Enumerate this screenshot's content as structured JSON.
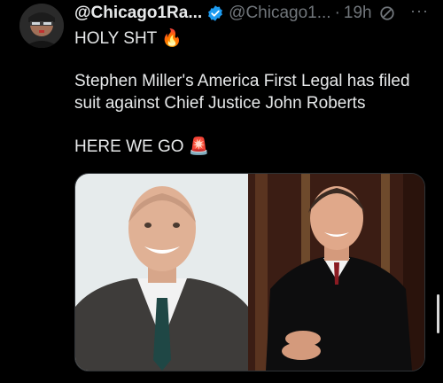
{
  "tweet": {
    "display_name": "@Chicago1Ra...",
    "handle": "@Chicago1...",
    "separator": "·",
    "time": "19h",
    "more": "···",
    "line1": "HOLY SHT",
    "line1_emoji": "🔥",
    "line2": "Stephen Miller's America First Legal has filed",
    "line3": "suit against Chief Justice John Roberts",
    "line4": "HERE WE GO",
    "line4_emoji": "🚨"
  },
  "colors": {
    "background": "#000000",
    "text": "#e7e9ea",
    "muted": "#71767b",
    "verified": "#1d9bf0"
  },
  "icons": {
    "verified": "verified-badge-icon",
    "no_symbol": "no-symbol-icon",
    "more": "more-options-icon"
  }
}
